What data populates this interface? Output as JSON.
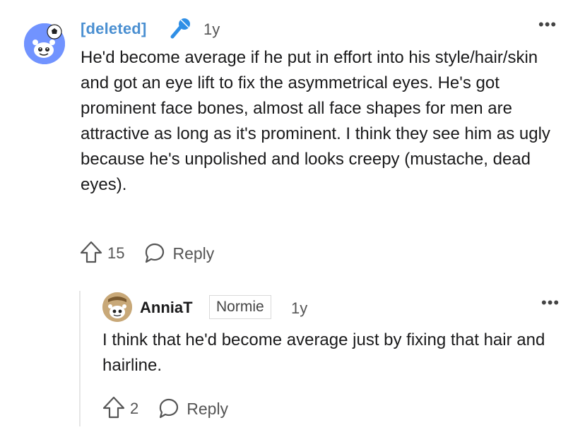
{
  "comment": {
    "author": "[deleted]",
    "age": "1y",
    "body": "He'd become average if he put in effort into his style/hair/skin and got an eye lift to fix the asymmetrical eyes. He's got prominent face bones, almost all face shapes for men are attractive as long as it's prominent. I think they see him as ugly because he's unpolished and looks creepy (mustache, dead eyes).",
    "votes": "15",
    "reply_label": "Reply",
    "more_label": "•••"
  },
  "reply": {
    "author": "AnniaT",
    "flair": "Normie",
    "age": "1y",
    "body": "I think that he'd become average just by fixing that hair and hairline.",
    "votes": "2",
    "reply_label": "Reply",
    "more_label": "•••"
  },
  "colors": {
    "username_link": "#4a8fd1",
    "mic_accent": "#2f8fe6",
    "avatar1_bg": "#7193ff",
    "avatar2_bg": "#c8a878",
    "thread_line": "#e6e6e6"
  },
  "icons": {
    "mic": "microphone-icon",
    "upvote": "upvote-arrow-icon",
    "reply": "speech-bubble-icon",
    "more": "more-dots-icon"
  }
}
